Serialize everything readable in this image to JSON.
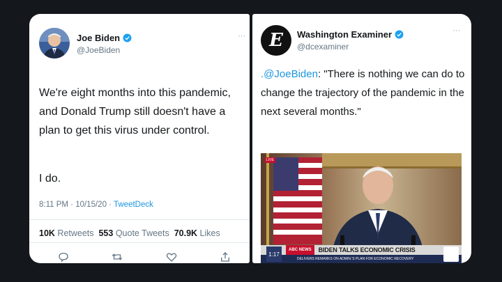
{
  "left_tweet": {
    "author_name": "Joe Biden",
    "handle": "@JoeBiden",
    "text_main": "We're eight months into this pandemic, and Donald Trump still doesn't have a plan to get this virus under control.",
    "text_tail": "I do.",
    "timestamp": "8:11 PM · 10/15/20 · ",
    "source": "TweetDeck",
    "retweets_count": "10K",
    "retweets_label": "Retweets",
    "quote_count": "553",
    "quote_label": "Quote Tweets",
    "likes_count": "70.9K",
    "likes_label": "Likes",
    "more_label": "···"
  },
  "right_tweet": {
    "author_name": "Washington Examiner",
    "handle": "@dcexaminer",
    "avatar_letter": "E",
    "mention": ".@JoeBiden",
    "text": ": \"There is nothing we can do to change the trajectory of the pandemic in the next several months.\"",
    "more_label": "···",
    "video": {
      "timecode": "1:17",
      "channel_tag": "ABC NEWS",
      "headline": "BIDEN TALKS ECONOMIC CRISIS",
      "subline": "DELIVERS REMARKS ON ADMIN.'S PLAN FOR ECONOMIC RECOVERY",
      "live_tag": "LIVE"
    }
  },
  "colors": {
    "background": "#14171c",
    "verified": "#1da1f2",
    "link": "#1b95e0"
  }
}
